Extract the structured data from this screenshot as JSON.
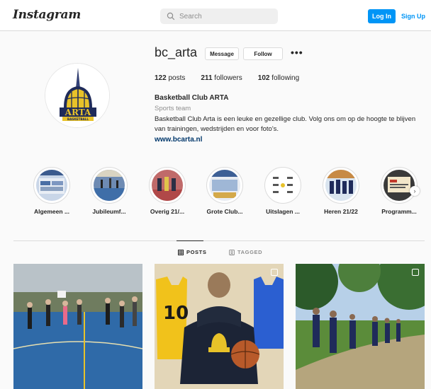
{
  "header": {
    "logo": "Instagram",
    "search_placeholder": "Search",
    "login_label": "Log In",
    "signup_label": "Sign Up"
  },
  "profile": {
    "username": "bc_arta",
    "message_label": "Message",
    "follow_label": "Follow",
    "more_label": "•••",
    "stats": {
      "posts_count": "122",
      "posts_label": " posts",
      "followers_count": "211",
      "followers_label": " followers",
      "following_count": "102",
      "following_label": " following"
    },
    "full_name": "Basketball Club ARTA",
    "category": "Sports team",
    "bio": "Basketball Club Arta is een leuke en gezellige club. Volg ons om op de hoogte te blijven van trainingen, wedstrijden en voor foto's.",
    "website": "www.bcarta.nl",
    "avatar_text": "ARTA",
    "avatar_subtext": "BASKETBALL"
  },
  "highlights": [
    {
      "label": "Algemeen ..."
    },
    {
      "label": "Jubileumf..."
    },
    {
      "label": "Overig 21/..."
    },
    {
      "label": "Grote Club..."
    },
    {
      "label": "Uitslagen ..."
    },
    {
      "label": "Heren 21/22"
    },
    {
      "label": "Programm..."
    }
  ],
  "tabs": {
    "posts": "POSTS",
    "tagged": "TAGGED"
  },
  "colors": {
    "accent": "#0095f6",
    "link": "#00376b",
    "border": "#dbdbdb",
    "muted": "#8e8e8e"
  }
}
